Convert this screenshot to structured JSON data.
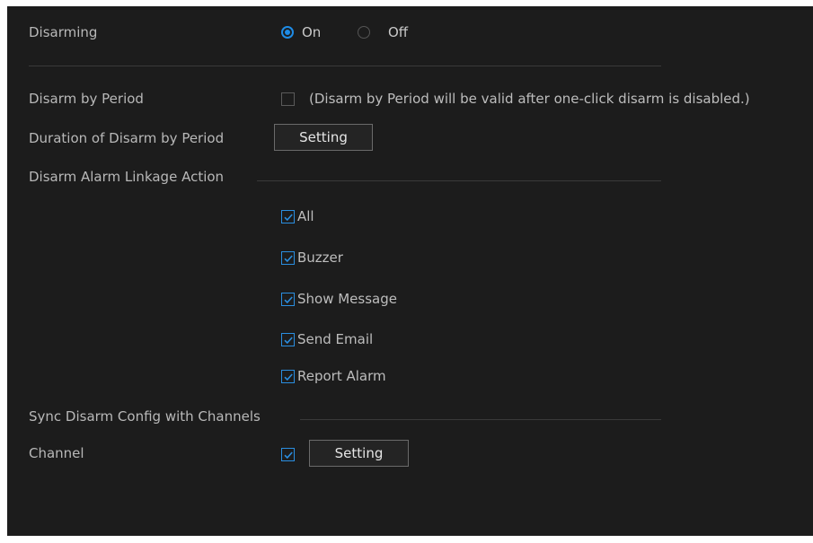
{
  "disarming": {
    "label": "Disarming",
    "option_on": "On",
    "option_off": "Off",
    "selected": "On"
  },
  "disarm_by_period": {
    "label": "Disarm by Period",
    "checked": false,
    "note": "(Disarm by Period will be valid after one-click disarm is disabled.)"
  },
  "duration": {
    "label": "Duration of Disarm by Period",
    "button": "Setting"
  },
  "linkage": {
    "label": "Disarm Alarm Linkage Action",
    "actions": [
      {
        "label": "All",
        "checked": true
      },
      {
        "label": "Buzzer",
        "checked": true
      },
      {
        "label": "Show Message",
        "checked": true
      },
      {
        "label": "Send Email",
        "checked": true
      },
      {
        "label": "Report Alarm",
        "checked": true
      }
    ]
  },
  "sync": {
    "label": "Sync Disarm Config with Channels"
  },
  "channel": {
    "label": "Channel",
    "checked": true,
    "button": "Setting"
  },
  "colors": {
    "accent": "#1e8ce6",
    "background": "#1c1c1c",
    "text": "#b8b8b8"
  }
}
